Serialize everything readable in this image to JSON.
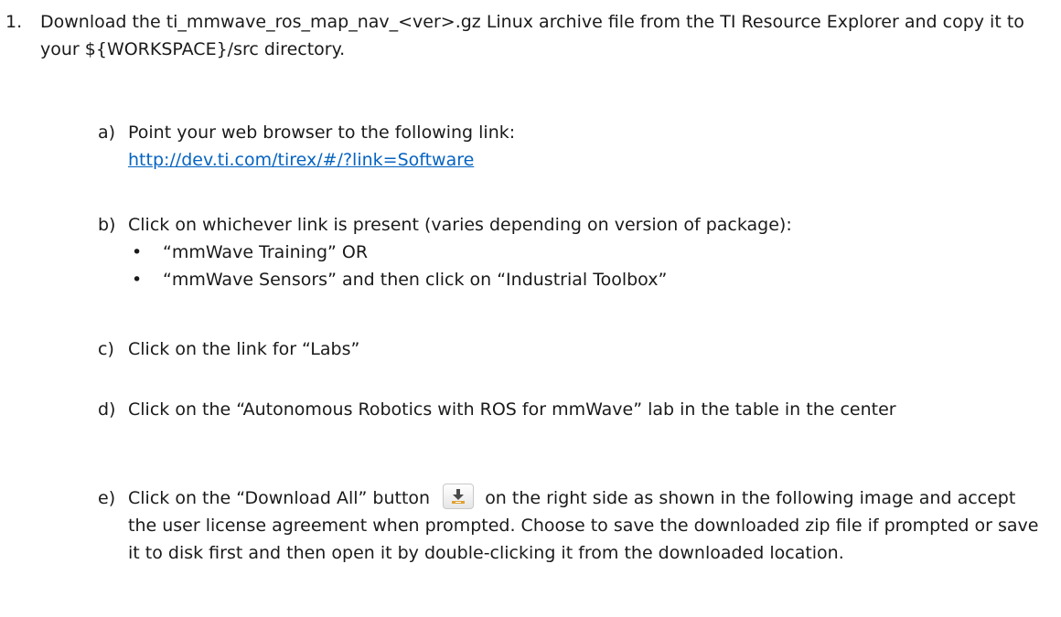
{
  "step": {
    "number": "1.",
    "text": "Download the ti_mmwave_ros_map_nav_<ver>.gz Linux archive file from the TI Resource Explorer and copy it to your ${WORKSPACE}/src directory."
  },
  "substeps": {
    "a": {
      "letter": "a)",
      "text": "Point your web browser to the following link:",
      "link": "http://dev.ti.com/tirex/#/?link=Software"
    },
    "b": {
      "letter": "b)",
      "text": "Click on whichever link is present (varies depending on version of package):",
      "bullets": [
        "“mmWave Training” OR",
        "“mmWave Sensors” and then click on “Industrial Toolbox”"
      ],
      "bullet_glyph": "•"
    },
    "c": {
      "letter": "c)",
      "text": "Click on the link for “Labs”"
    },
    "d": {
      "letter": "d)",
      "text": "Click on the “Autonomous Robotics with ROS for mmWave” lab in the table in the center"
    },
    "e": {
      "letter": "e)",
      "text_before": "Click on the “Download All” button",
      "icon": "download-icon",
      "text_after": "on the right side as shown in the following image and accept the user license agreement when prompted.  Choose to save the downloaded zip file if prompted or save it to disk first and then open it by double-clicking it from the downloaded location."
    }
  },
  "colors": {
    "text": "#1a1a1a",
    "link": "#0563c1",
    "icon_arrow": "#4a4a4a",
    "icon_tray": "#e0a030"
  }
}
